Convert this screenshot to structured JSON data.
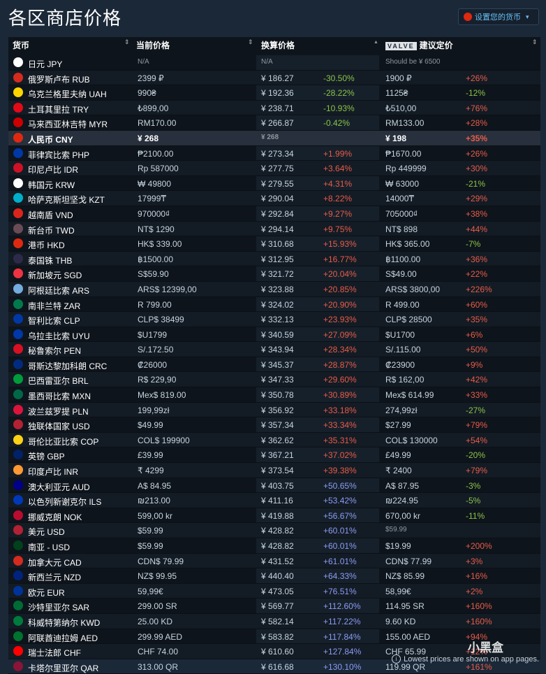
{
  "page_title": "各区商店价格",
  "currency_button": {
    "label": "设置您的货币",
    "caret": "▾"
  },
  "headers": {
    "currency": "货币",
    "current_price": "当前价格",
    "converted_price": "换算价格",
    "valve_badge": "VALVE",
    "suggested_price": "建议定价",
    "sort_glyph": "⇕",
    "sort_up_glyph": "▲"
  },
  "colors": {
    "positive": "#e85c4a",
    "negative": "#8bc34a",
    "blue": "#8b9cf4"
  },
  "rows": [
    {
      "flag": "#ffffff",
      "name": "日元 JPY",
      "current": "N/A",
      "converted": "N/A",
      "pct": "",
      "suggested": "Should be ¥ 6500",
      "sugpct": "",
      "muted": true
    },
    {
      "flag": "#d52b1e",
      "name": "俄罗斯卢布 RUB",
      "current": "2399 ₽",
      "converted": "¥ 186.27",
      "pct": "-30.50%",
      "suggested": "1900 ₽",
      "sugpct": "+26%"
    },
    {
      "flag": "#ffd500",
      "name": "乌克兰格里夫纳 UAH",
      "current": "990₴",
      "converted": "¥ 192.36",
      "pct": "-28.22%",
      "suggested": "1125₴",
      "sugpct": "-12%"
    },
    {
      "flag": "#e30a17",
      "name": "土耳其里拉 TRY",
      "current": "₺899,00",
      "converted": "¥ 238.71",
      "pct": "-10.93%",
      "suggested": "₺510,00",
      "sugpct": "+76%"
    },
    {
      "flag": "#cc0001",
      "name": "马来西亚林吉特 MYR",
      "current": "RM170.00",
      "converted": "¥ 266.87",
      "pct": "-0.42%",
      "suggested": "RM133.00",
      "sugpct": "+28%"
    },
    {
      "flag": "#de2910",
      "name": "人民币 CNY",
      "current": "¥ 268",
      "converted": "¥ 268",
      "pct": "",
      "suggested": "¥ 198",
      "sugpct": "+35%",
      "cny": true
    },
    {
      "flag": "#0038a8",
      "name": "菲律宾比索 PHP",
      "current": "₱2100.00",
      "converted": "¥ 273.34",
      "pct": "+1.99%",
      "suggested": "₱1670.00",
      "sugpct": "+26%"
    },
    {
      "flag": "#ce1126",
      "name": "印尼卢比 IDR",
      "current": "Rp 587000",
      "converted": "¥ 277.75",
      "pct": "+3.64%",
      "suggested": "Rp 449999",
      "sugpct": "+30%"
    },
    {
      "flag": "#ffffff",
      "name": "韩国元 KRW",
      "current": "₩ 49800",
      "converted": "¥ 279.55",
      "pct": "+4.31%",
      "suggested": "₩ 63000",
      "sugpct": "-21%"
    },
    {
      "flag": "#00afca",
      "name": "哈萨克斯坦坚戈 KZT",
      "current": "17999₸",
      "converted": "¥ 290.04",
      "pct": "+8.22%",
      "suggested": "14000₸",
      "sugpct": "+29%"
    },
    {
      "flag": "#da251d",
      "name": "越南盾 VND",
      "current": "970000₫",
      "converted": "¥ 292.84",
      "pct": "+9.27%",
      "suggested": "705000₫",
      "sugpct": "+38%"
    },
    {
      "flag": "#6b4b55",
      "name": "新台币 TWD",
      "current": "NT$ 1290",
      "converted": "¥ 294.14",
      "pct": "+9.75%",
      "suggested": "NT$ 898",
      "sugpct": "+44%"
    },
    {
      "flag": "#de2910",
      "name": "港币 HKD",
      "current": "HK$ 339.00",
      "converted": "¥ 310.68",
      "pct": "+15.93%",
      "suggested": "HK$ 365.00",
      "sugpct": "-7%"
    },
    {
      "flag": "#2d2a4a",
      "name": "泰国铢 THB",
      "current": "฿1500.00",
      "converted": "¥ 312.95",
      "pct": "+16.77%",
      "suggested": "฿1100.00",
      "sugpct": "+36%"
    },
    {
      "flag": "#ef3340",
      "name": "新加坡元 SGD",
      "current": "S$59.90",
      "converted": "¥ 321.72",
      "pct": "+20.04%",
      "suggested": "S$49.00",
      "sugpct": "+22%"
    },
    {
      "flag": "#74acdf",
      "name": "阿根廷比索 ARS",
      "current": "ARS$ 12399,00",
      "converted": "¥ 323.88",
      "pct": "+20.85%",
      "suggested": "ARS$ 3800,00",
      "sugpct": "+226%"
    },
    {
      "flag": "#007a4d",
      "name": "南非兰特 ZAR",
      "current": "R 799.00",
      "converted": "¥ 324.02",
      "pct": "+20.90%",
      "suggested": "R 499.00",
      "sugpct": "+60%"
    },
    {
      "flag": "#0039a6",
      "name": "智利比索 CLP",
      "current": "CLP$ 38499",
      "converted": "¥ 332.13",
      "pct": "+23.93%",
      "suggested": "CLP$ 28500",
      "sugpct": "+35%"
    },
    {
      "flag": "#0038a8",
      "name": "乌拉圭比索 UYU",
      "current": "$U1799",
      "converted": "¥ 340.59",
      "pct": "+27.09%",
      "suggested": "$U1700",
      "sugpct": "+6%"
    },
    {
      "flag": "#d91023",
      "name": "秘鲁索尔 PEN",
      "current": "S/.172.50",
      "converted": "¥ 343.94",
      "pct": "+28.34%",
      "suggested": "S/.115.00",
      "sugpct": "+50%"
    },
    {
      "flag": "#002b7f",
      "name": "哥斯达黎加科朗 CRC",
      "current": "₡26000",
      "converted": "¥ 345.37",
      "pct": "+28.87%",
      "suggested": "₡23900",
      "sugpct": "+9%"
    },
    {
      "flag": "#009c3b",
      "name": "巴西雷亚尔 BRL",
      "current": "R$ 229,90",
      "converted": "¥ 347.33",
      "pct": "+29.60%",
      "suggested": "R$ 162,00",
      "sugpct": "+42%"
    },
    {
      "flag": "#006847",
      "name": "墨西哥比索 MXN",
      "current": "Mex$ 819.00",
      "converted": "¥ 350.78",
      "pct": "+30.89%",
      "suggested": "Mex$ 614.99",
      "sugpct": "+33%"
    },
    {
      "flag": "#dc143c",
      "name": "波兰兹罗提 PLN",
      "current": "199,99zł",
      "converted": "¥ 356.92",
      "pct": "+33.18%",
      "suggested": "274,99zł",
      "sugpct": "-27%"
    },
    {
      "flag": "#b22234",
      "name": "独联体国家 USD",
      "current": "$49.99",
      "converted": "¥ 357.34",
      "pct": "+33.34%",
      "suggested": "$27.99",
      "sugpct": "+79%"
    },
    {
      "flag": "#fcd116",
      "name": "哥伦比亚比索 COP",
      "current": "COL$ 199900",
      "converted": "¥ 362.62",
      "pct": "+35.31%",
      "suggested": "COL$ 130000",
      "sugpct": "+54%"
    },
    {
      "flag": "#012169",
      "name": "英镑 GBP",
      "current": "£39.99",
      "converted": "¥ 367.21",
      "pct": "+37.02%",
      "suggested": "£49.99",
      "sugpct": "-20%"
    },
    {
      "flag": "#ff9933",
      "name": "印度卢比 INR",
      "current": "₹ 4299",
      "converted": "¥ 373.54",
      "pct": "+39.38%",
      "suggested": "₹ 2400",
      "sugpct": "+79%"
    },
    {
      "flag": "#00008b",
      "name": "澳大利亚元 AUD",
      "current": "A$ 84.95",
      "converted": "¥ 403.75",
      "pct": "+50.65%",
      "suggested": "A$ 87.95",
      "sugpct": "-3%"
    },
    {
      "flag": "#0038b8",
      "name": "以色列新谢克尔 ILS",
      "current": "₪213.00",
      "converted": "¥ 411.16",
      "pct": "+53.42%",
      "suggested": "₪224.95",
      "sugpct": "-5%"
    },
    {
      "flag": "#ba0c2f",
      "name": "挪威克朗 NOK",
      "current": "599,00 kr",
      "converted": "¥ 419.88",
      "pct": "+56.67%",
      "suggested": "670,00 kr",
      "sugpct": "-11%"
    },
    {
      "flag": "#b22234",
      "name": "美元 USD",
      "current": "$59.99",
      "converted": "¥ 428.82",
      "pct": "+60.01%",
      "suggested": "$59.99",
      "sugpct": "",
      "sugmuted": true
    },
    {
      "flag": "#01411c",
      "name": "南亚 - USD",
      "current": "$59.99",
      "converted": "¥ 428.82",
      "pct": "+60.01%",
      "suggested": "$19.99",
      "sugpct": "+200%"
    },
    {
      "flag": "#d52b1e",
      "name": "加拿大元 CAD",
      "current": "CDN$ 79.99",
      "converted": "¥ 431.52",
      "pct": "+61.01%",
      "suggested": "CDN$ 77.99",
      "sugpct": "+3%"
    },
    {
      "flag": "#00247d",
      "name": "新西兰元 NZD",
      "current": "NZ$ 99.95",
      "converted": "¥ 440.40",
      "pct": "+64.33%",
      "suggested": "NZ$ 85.99",
      "sugpct": "+16%"
    },
    {
      "flag": "#003399",
      "name": "欧元 EUR",
      "current": "59,99€",
      "converted": "¥ 473.05",
      "pct": "+76.51%",
      "suggested": "58,99€",
      "sugpct": "+2%"
    },
    {
      "flag": "#006c35",
      "name": "沙特里亚尔 SAR",
      "current": "299.00 SR",
      "converted": "¥ 569.77",
      "pct": "+112.60%",
      "suggested": "114.95 SR",
      "sugpct": "+160%"
    },
    {
      "flag": "#007a3d",
      "name": "科威特第纳尔 KWD",
      "current": "25.00 KD",
      "converted": "¥ 582.14",
      "pct": "+117.22%",
      "suggested": "9.60 KD",
      "sugpct": "+160%"
    },
    {
      "flag": "#00732f",
      "name": "阿联酋迪拉姆 AED",
      "current": "299.99 AED",
      "converted": "¥ 583.82",
      "pct": "+117.84%",
      "suggested": "155.00 AED",
      "sugpct": "+94%"
    },
    {
      "flag": "#ff0000",
      "name": "瑞士法郎 CHF",
      "current": "CHF 74.00",
      "converted": "¥ 610.60",
      "pct": "+127.84%",
      "suggested": "CHF 65.99",
      "sugpct": "+12%"
    },
    {
      "flag": "#8a1538",
      "name": "卡塔尔里亚尔 QAR",
      "current": "313.00 QR",
      "converted": "¥ 616.68",
      "pct": "+130.10%",
      "suggested": "119.99 QR",
      "sugpct": "+161%"
    }
  ],
  "footnote": "Lowest prices are shown on app pages.",
  "footnote_icon": "i",
  "watermark": "小黑盒"
}
